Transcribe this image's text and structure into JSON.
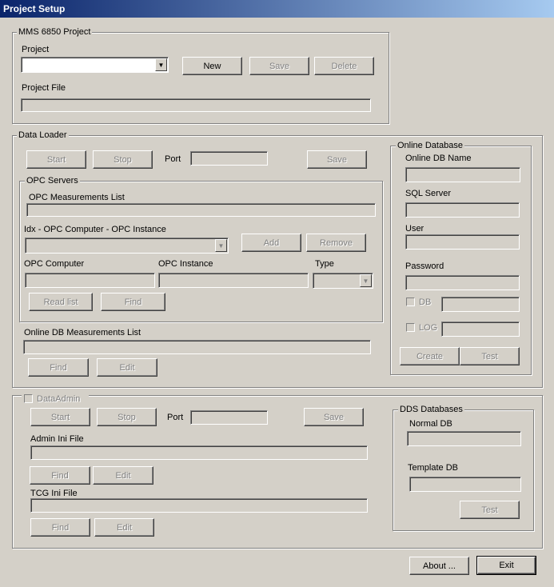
{
  "window": {
    "title": "Project Setup"
  },
  "mms_project": {
    "group_label": "MMS 6850 Project",
    "project_label": "Project",
    "project_value": "",
    "new_label": "New",
    "save_label": "Save",
    "delete_label": "Delete",
    "project_file_label": "Project File",
    "project_file_value": ""
  },
  "data_loader": {
    "group_label": "Data Loader",
    "start_label": "Start",
    "stop_label": "Stop",
    "port_label": "Port",
    "port_value": "",
    "save_label": "Save",
    "opc_servers": {
      "group_label": "OPC Servers",
      "measurements_list_label": "OPC Measurements List",
      "instance_combo_label": "Idx - OPC Computer - OPC Instance",
      "add_label": "Add",
      "remove_label": "Remove",
      "computer_label": "OPC Computer",
      "instance_label": "OPC Instance",
      "type_label": "Type",
      "read_list_label": "Read list",
      "find_label": "Find"
    },
    "online_db_list_label": "Online DB Measurements List",
    "find_label": "Find",
    "edit_label": "Edit"
  },
  "online_database": {
    "group_label": "Online Database",
    "db_name_label": "Online DB Name",
    "sql_server_label": "SQL Server",
    "user_label": "User",
    "password_label": "Password",
    "db_check_label": "DB",
    "log_check_label": "LOG",
    "create_label": "Create",
    "test_label": "Test"
  },
  "data_admin": {
    "check_label": "DataAdmin",
    "start_label": "Start",
    "stop_label": "Stop",
    "port_label": "Port",
    "save_label": "Save",
    "admin_ini_label": "Admin Ini File",
    "find_label": "Find",
    "edit_label": "Edit",
    "tcg_ini_label": "TCG Ini File",
    "find2_label": "Find",
    "edit2_label": "Edit"
  },
  "dds_databases": {
    "group_label": "DDS Databases",
    "normal_db_label": "Normal DB",
    "template_db_label": "Template DB",
    "test_label": "Test"
  },
  "footer": {
    "about_label": "About ...",
    "exit_label": "Exit"
  },
  "icons": {
    "dropdown": "chevron-down-icon"
  }
}
